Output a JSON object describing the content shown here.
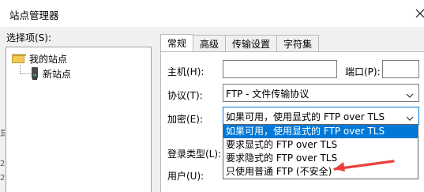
{
  "window": {
    "title": "站点管理器"
  },
  "sidebar": {
    "label": "选择项(S):",
    "tree": [
      {
        "label": "我的站点"
      },
      {
        "label": "新站点"
      }
    ]
  },
  "tabs": [
    {
      "label": "常规"
    },
    {
      "label": "高级"
    },
    {
      "label": "传输设置"
    },
    {
      "label": "字符集"
    }
  ],
  "form": {
    "host_label": "主机(H):",
    "host_value": "",
    "port_label": "端口(P):",
    "port_value": "",
    "protocol_label": "协议(T):",
    "protocol_value": "FTP - 文件传输协议",
    "encryption_label": "加密(E):",
    "encryption_value": "如果可用，使用显式的 FTP over TLS",
    "login_type_label": "登录类型(L):",
    "user_label": "用户(U):"
  },
  "encryption_options": [
    {
      "label": "如果可用，使用显式的 FTP over TLS",
      "selected": true
    },
    {
      "label": "要求显式的 FTP over TLS"
    },
    {
      "label": "要求隐式的 FTP over TLS"
    },
    {
      "label": "只使用普通 FTP (不安全)"
    }
  ],
  "colors": {
    "selection": "#0078d7",
    "annotation_arrow": "#e8413c"
  }
}
